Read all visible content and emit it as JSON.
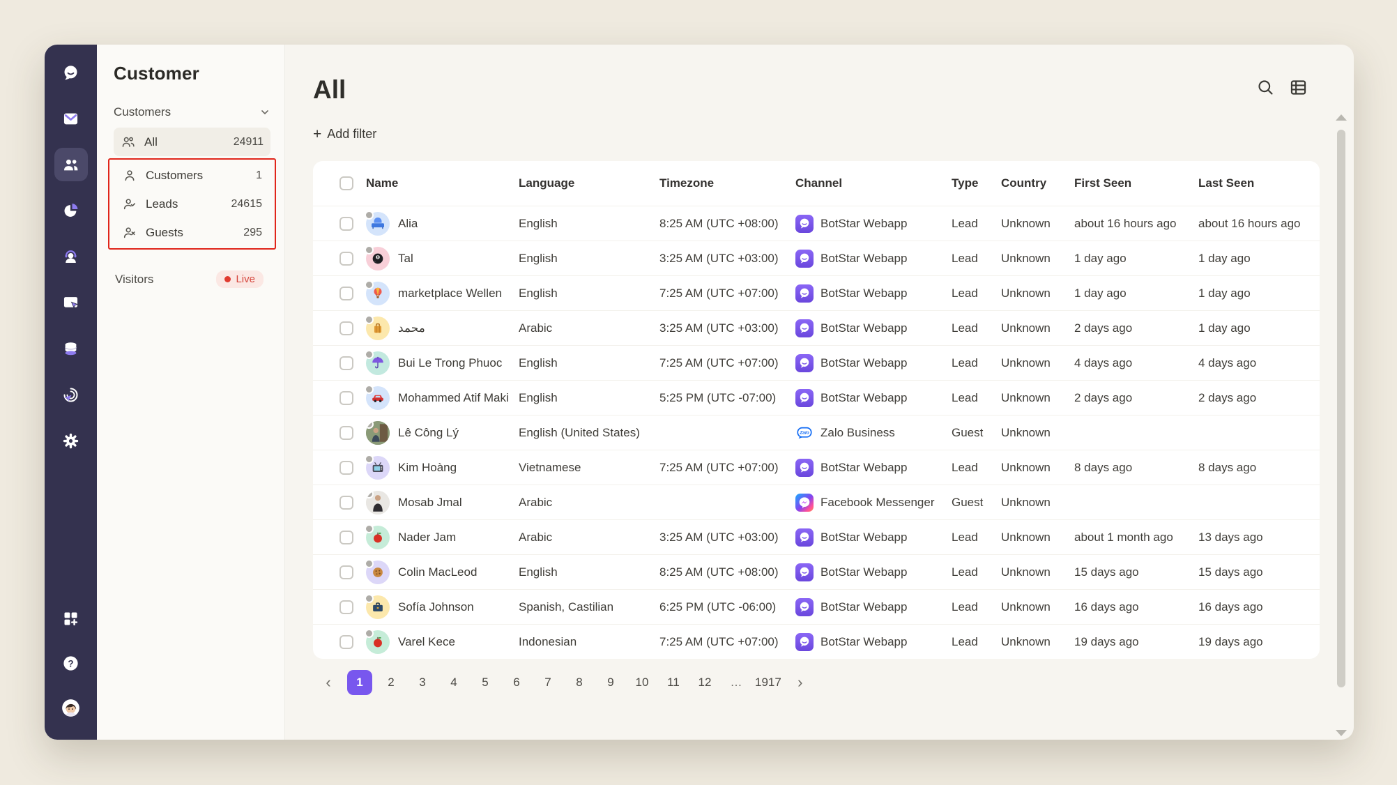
{
  "nav": {
    "icons": [
      "chat-logo",
      "inbox",
      "customers",
      "analytics",
      "live-agent",
      "widget",
      "database",
      "automation",
      "settings",
      "apps",
      "help",
      "profile"
    ]
  },
  "panel": {
    "title": "Customer",
    "section_label": "Customers",
    "items": [
      {
        "label": "All",
        "count": "24911",
        "icon": "people-group",
        "active": true,
        "highlighted": false
      },
      {
        "label": "Customers",
        "count": "1",
        "icon": "person",
        "active": false,
        "highlighted": true
      },
      {
        "label": "Leads",
        "count": "24615",
        "icon": "person-check",
        "active": false,
        "highlighted": true
      },
      {
        "label": "Guests",
        "count": "295",
        "icon": "person-x",
        "active": false,
        "highlighted": true
      }
    ],
    "visitors_label": "Visitors",
    "live_badge": "Live"
  },
  "main": {
    "title": "All",
    "add_filter_plus": "+",
    "add_filter_label": "Add filter"
  },
  "table": {
    "columns": [
      "Name",
      "Language",
      "Timezone",
      "Channel",
      "Type",
      "Country",
      "First Seen",
      "Last Seen"
    ],
    "rows": [
      {
        "name": "Alia",
        "avatar": "couch",
        "avatar_bg": "#d4e4fb",
        "language": "English",
        "timezone": "8:25 AM (UTC +08:00)",
        "channel": "BotStar Webapp",
        "channel_icon": "botstar",
        "type": "Lead",
        "country": "Unknown",
        "first_seen": "about 16 hours ago",
        "last_seen": "about 16 hours ago"
      },
      {
        "name": "Tal",
        "avatar": "pool-8-ball",
        "avatar_bg": "#f8cfd8",
        "language": "English",
        "timezone": "3:25 AM (UTC +03:00)",
        "channel": "BotStar Webapp",
        "channel_icon": "botstar",
        "type": "Lead",
        "country": "Unknown",
        "first_seen": "1 day ago",
        "last_seen": "1 day ago"
      },
      {
        "name": "marketplace Wellen",
        "avatar": "hot-air-balloon",
        "avatar_bg": "#d4e4fb",
        "language": "English",
        "timezone": "7:25 AM (UTC +07:00)",
        "channel": "BotStar Webapp",
        "channel_icon": "botstar",
        "type": "Lead",
        "country": "Unknown",
        "first_seen": "1 day ago",
        "last_seen": "1 day ago"
      },
      {
        "name": "محمد",
        "avatar": "luggage",
        "avatar_bg": "#fce8ac",
        "language": "Arabic",
        "timezone": "3:25 AM (UTC +03:00)",
        "channel": "BotStar Webapp",
        "channel_icon": "botstar",
        "type": "Lead",
        "country": "Unknown",
        "first_seen": "2 days ago",
        "last_seen": "1 day ago"
      },
      {
        "name": "Bui Le Trong Phuoc",
        "avatar": "umbrella",
        "avatar_bg": "#c2e9df",
        "language": "English",
        "timezone": "7:25 AM (UTC +07:00)",
        "channel": "BotStar Webapp",
        "channel_icon": "botstar",
        "type": "Lead",
        "country": "Unknown",
        "first_seen": "4 days ago",
        "last_seen": "4 days ago"
      },
      {
        "name": "Mohammed Atif Maki",
        "avatar": "car",
        "avatar_bg": "#d4e4fb",
        "language": "English",
        "timezone": "5:25 PM (UTC -07:00)",
        "channel": "BotStar Webapp",
        "channel_icon": "botstar",
        "type": "Lead",
        "country": "Unknown",
        "first_seen": "2 days ago",
        "last_seen": "2 days ago"
      },
      {
        "name": "Lê Công Lý",
        "avatar": "photo-outdoor",
        "avatar_bg": "#8a9a77",
        "language": "English (United States)",
        "timezone": "",
        "channel": "Zalo Business",
        "channel_icon": "zalo",
        "type": "Guest",
        "country": "Unknown",
        "first_seen": "",
        "last_seen": ""
      },
      {
        "name": "Kim Hoàng",
        "avatar": "tv",
        "avatar_bg": "#dcd7f8",
        "language": "Vietnamese",
        "timezone": "7:25 AM (UTC +07:00)",
        "channel": "BotStar Webapp",
        "channel_icon": "botstar",
        "type": "Lead",
        "country": "Unknown",
        "first_seen": "8 days ago",
        "last_seen": "8 days ago"
      },
      {
        "name": "Mosab Jmal",
        "avatar": "photo-person",
        "avatar_bg": "#e9e7e3",
        "language": "Arabic",
        "timezone": "",
        "channel": "Facebook Messenger",
        "channel_icon": "messenger",
        "type": "Guest",
        "country": "Unknown",
        "first_seen": "",
        "last_seen": ""
      },
      {
        "name": "Nader Jam",
        "avatar": "apple",
        "avatar_bg": "#c5ecd8",
        "language": "Arabic",
        "timezone": "3:25 AM (UTC +03:00)",
        "channel": "BotStar Webapp",
        "channel_icon": "botstar",
        "type": "Lead",
        "country": "Unknown",
        "first_seen": "about 1 month ago",
        "last_seen": "13 days ago"
      },
      {
        "name": "Colin MacLeod",
        "avatar": "cookie",
        "avatar_bg": "#dcd7f8",
        "language": "English",
        "timezone": "8:25 AM (UTC +08:00)",
        "channel": "BotStar Webapp",
        "channel_icon": "botstar",
        "type": "Lead",
        "country": "Unknown",
        "first_seen": "15 days ago",
        "last_seen": "15 days ago"
      },
      {
        "name": "Sofía Johnson",
        "avatar": "briefcase",
        "avatar_bg": "#fce8ac",
        "language": "Spanish, Castilian",
        "timezone": "6:25 PM (UTC -06:00)",
        "channel": "BotStar Webapp",
        "channel_icon": "botstar",
        "type": "Lead",
        "country": "Unknown",
        "first_seen": "16 days ago",
        "last_seen": "16 days ago"
      },
      {
        "name": "Varel Kece",
        "avatar": "apple",
        "avatar_bg": "#c5ecd8",
        "language": "Indonesian",
        "timezone": "7:25 AM (UTC +07:00)",
        "channel": "BotStar Webapp",
        "channel_icon": "botstar",
        "type": "Lead",
        "country": "Unknown",
        "first_seen": "19 days ago",
        "last_seen": "19 days ago"
      }
    ]
  },
  "pagination": {
    "prev": "‹",
    "next": "›",
    "pages": [
      "1",
      "2",
      "3",
      "4",
      "5",
      "6",
      "7",
      "8",
      "9",
      "10",
      "11",
      "12",
      "…",
      "1917"
    ],
    "active": "1"
  },
  "colors": {
    "accent_purple": "#7857ee",
    "nav_background": "#34324f",
    "highlight_red": "#e0251a",
    "live_red": "#d5453c",
    "card_background": "#ffffff"
  }
}
